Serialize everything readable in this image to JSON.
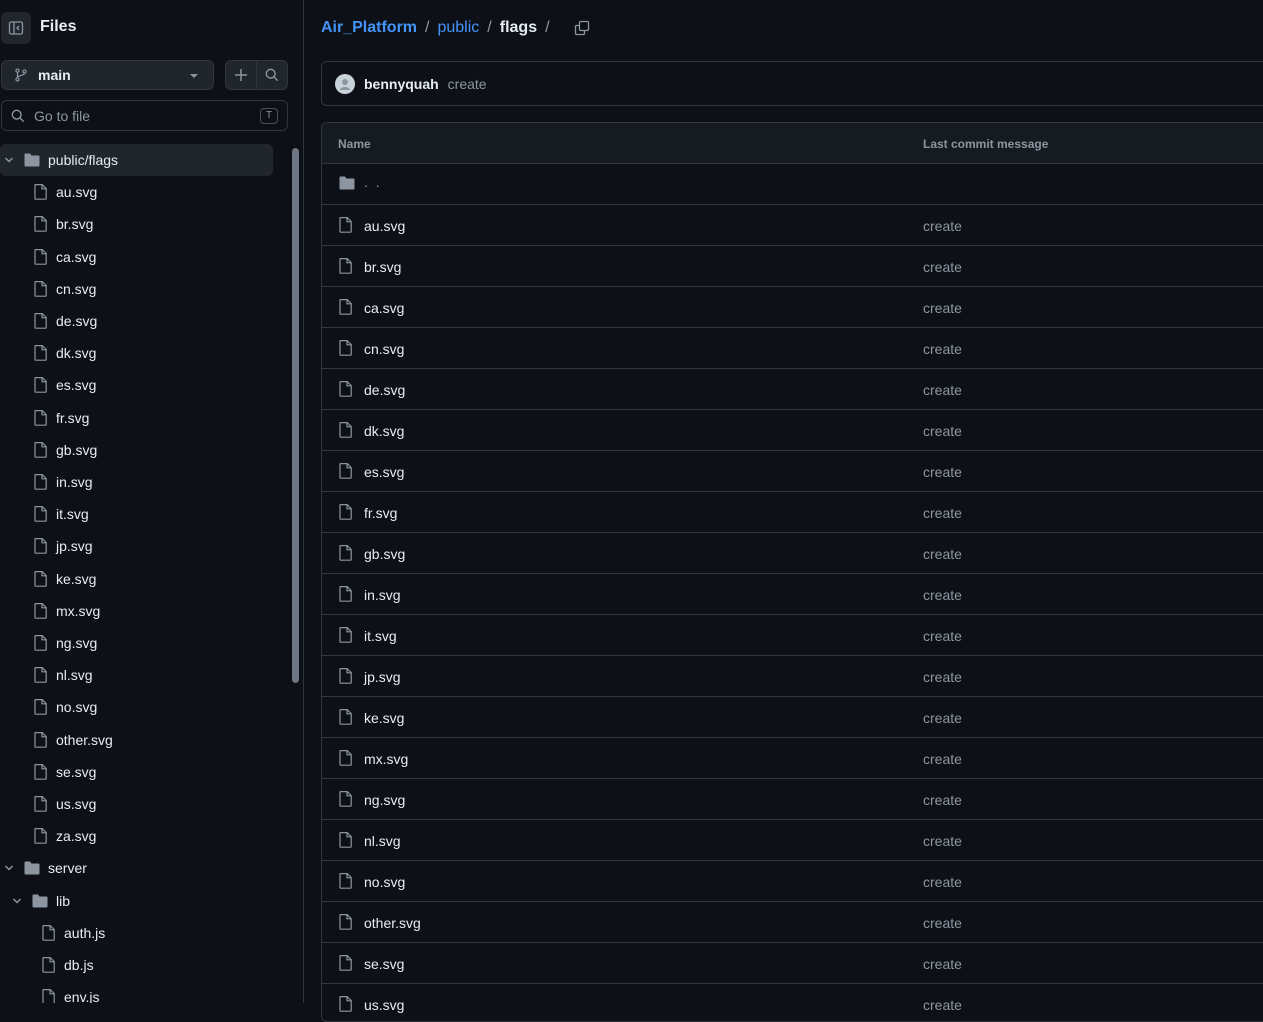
{
  "sidebar": {
    "title": "Files",
    "branch": "main",
    "search_placeholder": "Go to file",
    "search_shortcut": "T",
    "tree": [
      {
        "label": "public/flags",
        "type": "folder",
        "expanded": true,
        "depth": 0,
        "selected": true
      },
      {
        "label": "au.svg",
        "type": "file",
        "depth": 1
      },
      {
        "label": "br.svg",
        "type": "file",
        "depth": 1
      },
      {
        "label": "ca.svg",
        "type": "file",
        "depth": 1
      },
      {
        "label": "cn.svg",
        "type": "file",
        "depth": 1
      },
      {
        "label": "de.svg",
        "type": "file",
        "depth": 1
      },
      {
        "label": "dk.svg",
        "type": "file",
        "depth": 1
      },
      {
        "label": "es.svg",
        "type": "file",
        "depth": 1
      },
      {
        "label": "fr.svg",
        "type": "file",
        "depth": 1
      },
      {
        "label": "gb.svg",
        "type": "file",
        "depth": 1
      },
      {
        "label": "in.svg",
        "type": "file",
        "depth": 1
      },
      {
        "label": "it.svg",
        "type": "file",
        "depth": 1
      },
      {
        "label": "jp.svg",
        "type": "file",
        "depth": 1
      },
      {
        "label": "ke.svg",
        "type": "file",
        "depth": 1
      },
      {
        "label": "mx.svg",
        "type": "file",
        "depth": 1
      },
      {
        "label": "ng.svg",
        "type": "file",
        "depth": 1
      },
      {
        "label": "nl.svg",
        "type": "file",
        "depth": 1
      },
      {
        "label": "no.svg",
        "type": "file",
        "depth": 1
      },
      {
        "label": "other.svg",
        "type": "file",
        "depth": 1
      },
      {
        "label": "se.svg",
        "type": "file",
        "depth": 1
      },
      {
        "label": "us.svg",
        "type": "file",
        "depth": 1
      },
      {
        "label": "za.svg",
        "type": "file",
        "depth": 1
      },
      {
        "label": "server",
        "type": "folder",
        "expanded": true,
        "depth": 0
      },
      {
        "label": "lib",
        "type": "folder",
        "expanded": true,
        "depth": 1
      },
      {
        "label": "auth.js",
        "type": "file",
        "depth": 2
      },
      {
        "label": "db.js",
        "type": "file",
        "depth": 2
      },
      {
        "label": "env.js",
        "type": "file",
        "depth": 2
      }
    ]
  },
  "breadcrumb": {
    "repo": "Air_Platform",
    "folder": "public",
    "current": "flags",
    "separator": "/"
  },
  "commit": {
    "author": "bennyquah",
    "message": "create"
  },
  "table": {
    "headers": {
      "name": "Name",
      "message": "Last commit message"
    },
    "parent_label": ". .",
    "rows": [
      {
        "name": "au.svg",
        "message": "create"
      },
      {
        "name": "br.svg",
        "message": "create"
      },
      {
        "name": "ca.svg",
        "message": "create"
      },
      {
        "name": "cn.svg",
        "message": "create"
      },
      {
        "name": "de.svg",
        "message": "create"
      },
      {
        "name": "dk.svg",
        "message": "create"
      },
      {
        "name": "es.svg",
        "message": "create"
      },
      {
        "name": "fr.svg",
        "message": "create"
      },
      {
        "name": "gb.svg",
        "message": "create"
      },
      {
        "name": "in.svg",
        "message": "create"
      },
      {
        "name": "it.svg",
        "message": "create"
      },
      {
        "name": "jp.svg",
        "message": "create"
      },
      {
        "name": "ke.svg",
        "message": "create"
      },
      {
        "name": "mx.svg",
        "message": "create"
      },
      {
        "name": "ng.svg",
        "message": "create"
      },
      {
        "name": "nl.svg",
        "message": "create"
      },
      {
        "name": "no.svg",
        "message": "create"
      },
      {
        "name": "other.svg",
        "message": "create"
      },
      {
        "name": "se.svg",
        "message": "create"
      },
      {
        "name": "us.svg",
        "message": "create"
      }
    ]
  },
  "colors": {
    "background": "#0d1117",
    "border": "#30363d",
    "link": "#4493f8",
    "muted": "#8d96a0",
    "text": "#e6edf3"
  }
}
